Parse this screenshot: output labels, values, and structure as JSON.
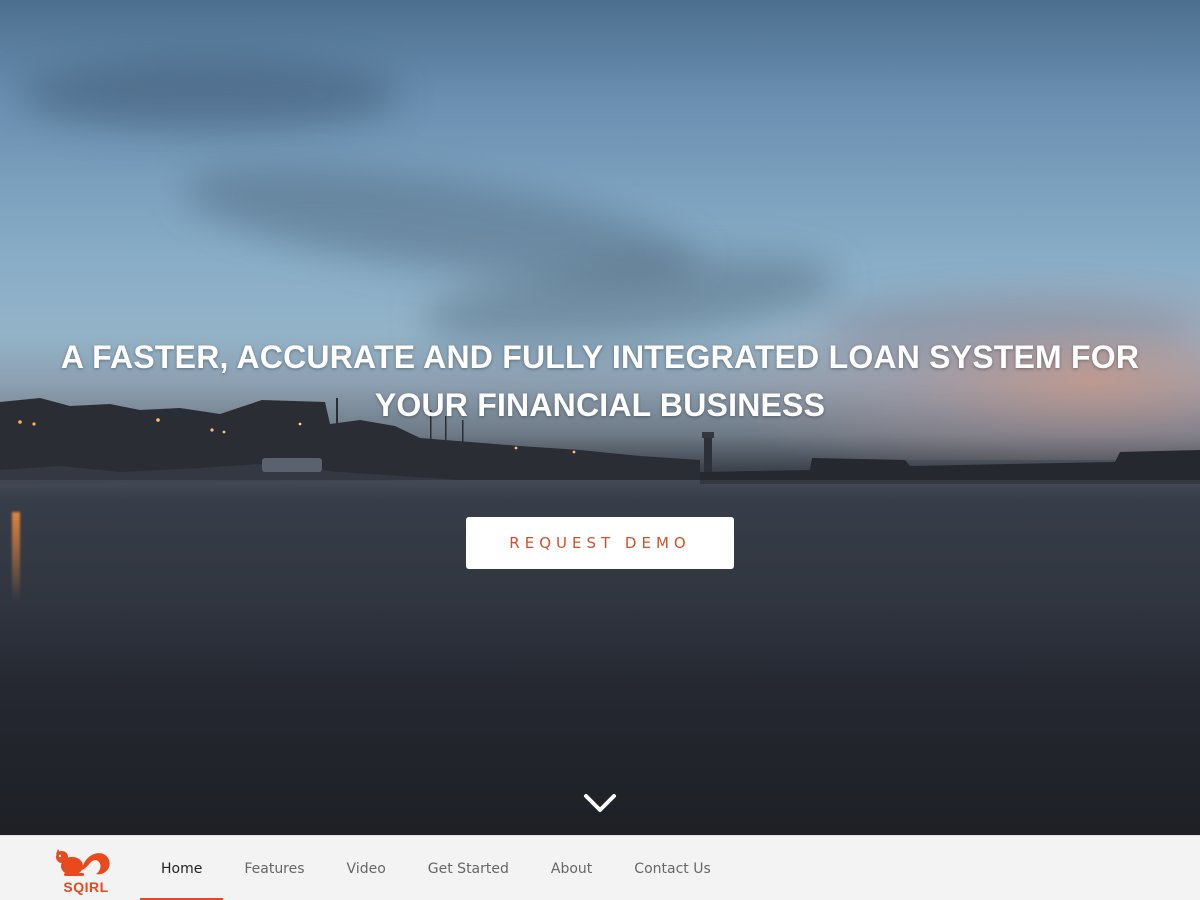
{
  "hero": {
    "headline": "A FASTER, ACCURATE AND FULLY INTEGRATED LOAN SYSTEM FOR YOUR FINANCIAL BUSINESS",
    "cta_label": "REQUEST DEMO"
  },
  "brand": {
    "name": "SQIRL",
    "color": "#e8491d"
  },
  "nav": {
    "items": [
      {
        "label": "Home",
        "active": true
      },
      {
        "label": "Features",
        "active": false
      },
      {
        "label": "Video",
        "active": false
      },
      {
        "label": "Get Started",
        "active": false
      },
      {
        "label": "About",
        "active": false
      },
      {
        "label": "Contact Us",
        "active": false
      }
    ]
  },
  "icons": {
    "scroll": "chevron-down-icon",
    "logo": "squirrel-logo-icon"
  }
}
